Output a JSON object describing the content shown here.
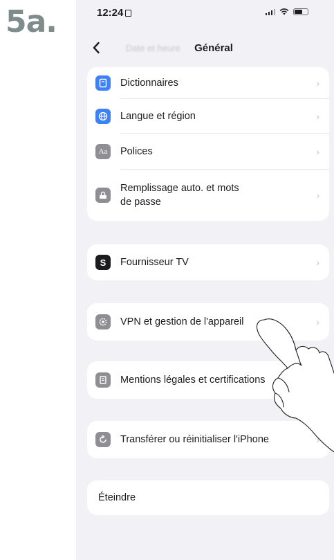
{
  "step_label": "5a.",
  "status_bar": {
    "time": "12:24"
  },
  "nav": {
    "back_label": "Date et heure",
    "title": "Général"
  },
  "group1": [
    {
      "label": "Dictionnaires",
      "icon": "dictionary-icon",
      "color": "#3c82f6"
    },
    {
      "label": "Langue et région",
      "icon": "globe-icon",
      "color": "#3c82f6"
    },
    {
      "label": "Polices",
      "icon": "fonts-icon",
      "color": "#8e8e93"
    },
    {
      "label": "Remplissage auto. et mots\nde passe",
      "icon": "autofill-icon",
      "color": "#8e8e93"
    }
  ],
  "group2": [
    {
      "label": "Fournisseur TV",
      "icon": "tv-provider-icon",
      "color": "#1c1c1e"
    }
  ],
  "group3": [
    {
      "label": "VPN et gestion de l'appareil",
      "icon": "gear-icon",
      "color": "#8e8e93"
    }
  ],
  "group4": [
    {
      "label": "Mentions légales et certifications",
      "icon": "legal-icon",
      "color": "#8e8e93"
    }
  ],
  "group5": [
    {
      "label": "Transférer ou réinitialiser l'iPhone",
      "icon": "reset-icon",
      "color": "#8e8e93"
    }
  ],
  "group6": {
    "label": "Éteindre",
    "color": "#1f6fe0"
  }
}
